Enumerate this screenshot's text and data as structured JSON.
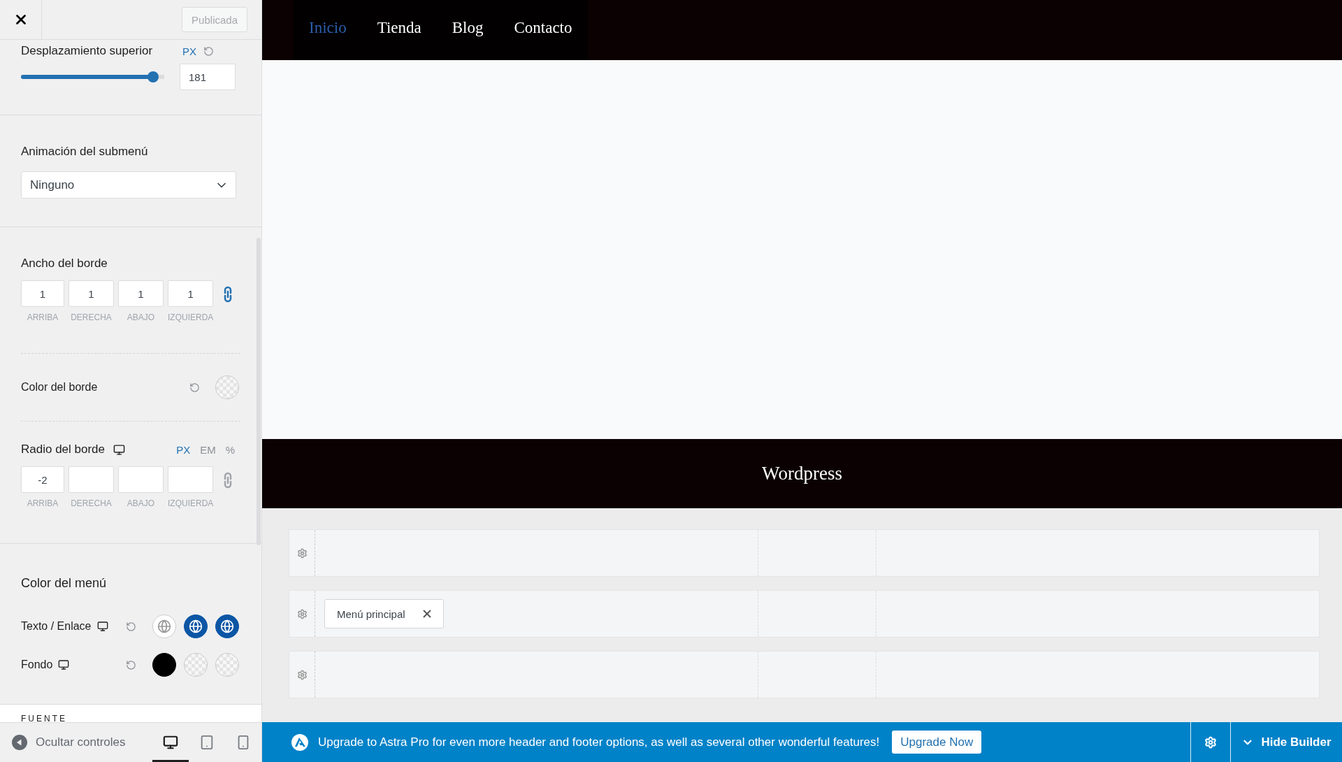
{
  "header": {
    "publish_button": "Publicada"
  },
  "top_offset": {
    "label": "Desplazamiento superior",
    "unit": "PX",
    "level": 0.92,
    "value": "181"
  },
  "submenu_animation": {
    "label": "Animación del submenú",
    "value": "Ninguno"
  },
  "border_width": {
    "label": "Ancho del borde",
    "linked": true,
    "fields": [
      {
        "value": "1",
        "label": "ARRIBA"
      },
      {
        "value": "1",
        "label": "DERECHA"
      },
      {
        "value": "1",
        "label": "ABAJO"
      },
      {
        "value": "1",
        "label": "IZQUIERDA"
      }
    ]
  },
  "border_color": {
    "label": "Color del borde"
  },
  "border_radius": {
    "label": "Radio del borde",
    "linked": false,
    "units": [
      {
        "label": "PX",
        "selected": true
      },
      {
        "label": "EM",
        "selected": false
      },
      {
        "label": "%",
        "selected": false
      }
    ],
    "fields": [
      {
        "value": "-2",
        "label": "ARRIBA"
      },
      {
        "label": "DERECHA"
      },
      {
        "label": "ABAJO"
      },
      {
        "label": "IZQUIERDA"
      }
    ]
  },
  "menu_color": {
    "title": "Color del menú",
    "rows": [
      {
        "label": "Texto / Enlace",
        "swatches": [
          {
            "kind": "global",
            "color": "#ffffff"
          },
          {
            "kind": "global",
            "color": "#0b56a5"
          },
          {
            "kind": "global",
            "color": "#0b56a5"
          }
        ]
      },
      {
        "label": "Fondo",
        "swatches": [
          {
            "kind": "solid",
            "color": "#000000"
          },
          {
            "kind": "empty"
          },
          {
            "kind": "empty"
          }
        ]
      }
    ]
  },
  "font_section": {
    "title": "FUENTE"
  },
  "panel_footer": {
    "hide_label": "Ocultar controles",
    "devices": [
      {
        "kind": "desktop",
        "selected": true
      },
      {
        "kind": "tablet",
        "selected": false
      },
      {
        "kind": "mobile",
        "selected": false
      }
    ]
  },
  "preview": {
    "nav": [
      {
        "label": "Inicio",
        "selected": true
      },
      {
        "label": "Tienda",
        "selected": false
      },
      {
        "label": "Blog",
        "selected": false
      },
      {
        "label": "Contacto",
        "selected": false
      }
    ],
    "footer_title": "Wordpress"
  },
  "builder": {
    "rows": [
      {
        "kind": "empty"
      },
      {
        "kind": "filled",
        "items": [
          {
            "label": "Menú principal"
          }
        ]
      },
      {
        "kind": "empty"
      }
    ]
  },
  "upgrade_bar": {
    "message": "Upgrade to Astra Pro for even more header and footer options, as well as several other wonderful features!",
    "button": "Upgrade Now",
    "hide_builder": "Hide Builder"
  }
}
